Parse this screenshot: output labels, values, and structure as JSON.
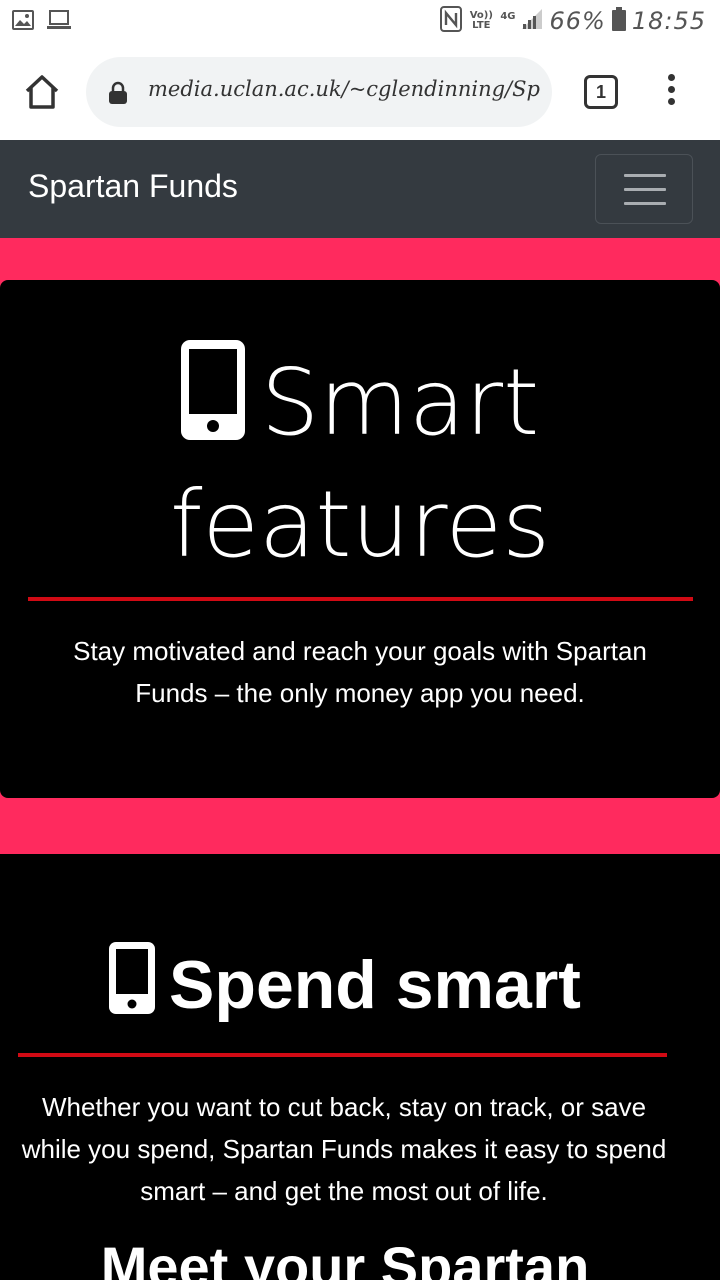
{
  "status_bar": {
    "network_label": "Vo)) LTE",
    "data_label": "4G",
    "battery": "66%",
    "time": "18:55"
  },
  "browser": {
    "url": "media.uclan.ac.uk/~cglendinning/Spartan",
    "tab_count": "1"
  },
  "navbar": {
    "brand": "Spartan Funds"
  },
  "hero": {
    "title": "Smart features",
    "text": "Stay motivated and reach your goals with Spartan Funds – the only money app you need."
  },
  "section_spend": {
    "title": "Spend smart",
    "text": "Whether you want to cut back, stay on track, or save while you spend, Spartan Funds makes it easy to spend smart – and get the most out of life."
  },
  "section_meet": {
    "title": "Meet your Spartan"
  },
  "colors": {
    "accent_pink": "#ff2a5e",
    "divider_red": "#d10a14",
    "navbar": "#343a40"
  }
}
